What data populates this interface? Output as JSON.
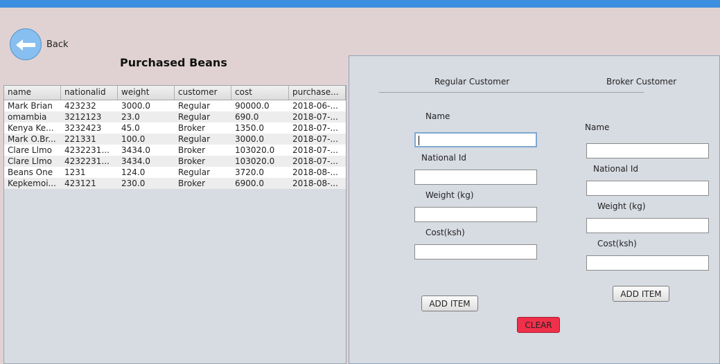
{
  "header": {
    "back_label": "Back",
    "title": "Purchased Beans"
  },
  "table": {
    "columns": [
      "name",
      "nationalid",
      "weight",
      "customer",
      "cost",
      "purchase..."
    ],
    "rows": [
      [
        "Mark Brian",
        "423232",
        "3000.0",
        "Regular",
        "90000.0",
        "2018-06-..."
      ],
      [
        "omambia",
        "3212123",
        "23.0",
        "Regular",
        "690.0",
        "2018-07-..."
      ],
      [
        "Kenya Ke...",
        "3232423",
        "45.0",
        "Broker",
        "1350.0",
        "2018-07-..."
      ],
      [
        "Mark O.Br...",
        "221331",
        "100.0",
        "Regular",
        "3000.0",
        "2018-07-..."
      ],
      [
        "Clare Llmo",
        "4232231...",
        "3434.0",
        "Broker",
        "103020.0",
        "2018-07-..."
      ],
      [
        "Clare Llmo",
        "4232231...",
        "3434.0",
        "Broker",
        "103020.0",
        "2018-07-..."
      ],
      [
        "Beans One",
        "1231",
        "124.0",
        "Regular",
        "3720.0",
        "2018-08-..."
      ],
      [
        "Kepkemoi...",
        "423121",
        "230.0",
        "Broker",
        "6900.0",
        "2018-08-..."
      ]
    ]
  },
  "form": {
    "tabs": {
      "regular": "Regular Customer",
      "broker": "Broker Customer"
    },
    "regular": {
      "name_label": "Name",
      "name_value": "",
      "national_id_label": "National Id",
      "national_id_value": "",
      "weight_label": "Weight (kg)",
      "weight_value": "",
      "cost_label": "Cost(ksh)",
      "cost_value": "",
      "add_button": "ADD ITEM"
    },
    "broker": {
      "name_label": "Name",
      "name_value": "",
      "national_id_label": "National Id",
      "national_id_value": "",
      "weight_label": "Weight (kg)",
      "weight_value": "",
      "cost_label": "Cost(ksh)",
      "cost_value": "",
      "add_button": "ADD ITEM"
    },
    "clear_button": "CLEAR"
  },
  "colors": {
    "topbar": "#3c8ede",
    "clear_button": "#f0304a",
    "back_button": "#86bff0"
  },
  "icons": {
    "back": "arrow-left-icon"
  }
}
